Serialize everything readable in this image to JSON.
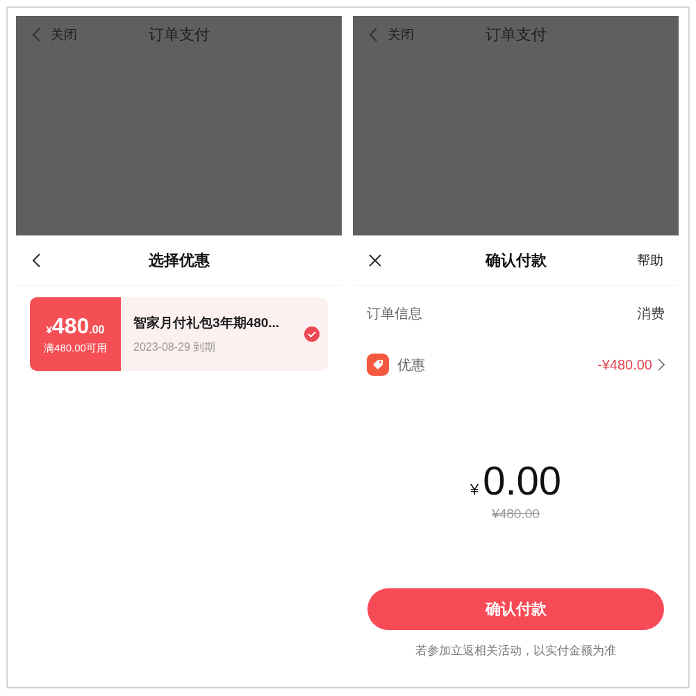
{
  "coupon_screen": {
    "overlay": {
      "back_label": "关闭",
      "title": "订单支付"
    },
    "sheet_title": "选择优惠",
    "coupons": [
      {
        "currency": "¥",
        "amount": "480",
        "cents": ".00",
        "condition": "满480.00可用",
        "name": "智家月付礼包3年期480...",
        "expiry": "2023-08-29 到期",
        "selected": true
      }
    ]
  },
  "payment_screen": {
    "overlay": {
      "back_label": "关闭",
      "title": "订单支付"
    },
    "sheet_title": "确认付款",
    "help": "帮助",
    "order_info": {
      "label": "订单信息",
      "value": "消费"
    },
    "discount": {
      "label": "优惠",
      "value": "-¥480.00"
    },
    "total": {
      "currency": "¥",
      "amount": "0.00",
      "original": "¥480.00"
    },
    "confirm_button": "确认付款",
    "note": "若参加立返相关活动，以实付金额为准"
  }
}
